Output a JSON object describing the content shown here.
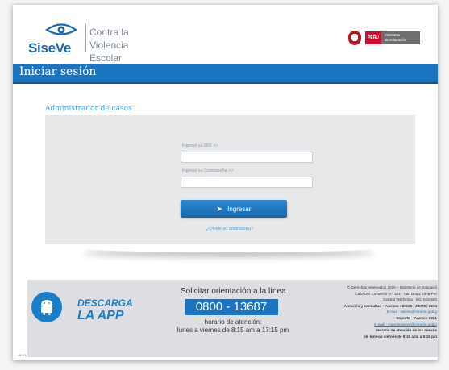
{
  "header": {
    "brand": "SiseVe",
    "subtitle_line1": "Contra la",
    "subtitle_line2": "Violencia Escolar",
    "peru_label": "PERÚ",
    "ministry_line1": "Ministerio",
    "ministry_line2": "de Educación"
  },
  "title_bar": {
    "title": "Iniciar sesión"
  },
  "login": {
    "section_title": "Administrador de casos",
    "dni_label": "Ingrese su DNI >>",
    "dni_value": "",
    "password_label": "Ingrese su Contraseña >>",
    "password_value": "",
    "submit_label": "Ingresar",
    "forgot_label": "¿Olvidó su contraseña?"
  },
  "footer": {
    "download_line1": "DESCARGA",
    "download_line2": "LA APP",
    "orientation_label": "Solicitar orientación a la línea",
    "phone": "0800 - 13687",
    "hours_title": "horario de atención:",
    "hours_value": "lunes a viernes de 8:15 am a 17:15 pm",
    "legal_lines": [
      "© Derechos reservados 2015 – Ministerio de Educació",
      "Calle Del Comercio N.º 193 · San Borja, Lima-Per",
      "Central Telefónica : (01) 615-580",
      "Atención y consultas – Anexos : 22159 / 22078 / 2234",
      "E-mail : siseve@minedu.gob.p",
      "Soporte – Anexo : 2221",
      "E-mail : soportesiseve@minedu.gob.p",
      "Horario de atención de los anexos",
      "de lunes a viernes de 8:15 a.m. a 5:15 p.n"
    ],
    "version": "v8.1.3"
  },
  "colors": {
    "accent": "#1a74c2",
    "brand": "#1c66b1",
    "link": "#4aa3e3"
  }
}
